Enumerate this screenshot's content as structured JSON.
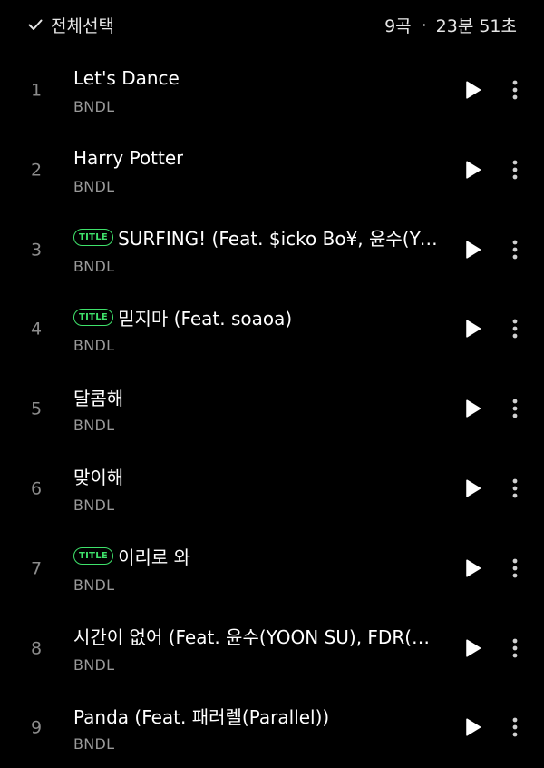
{
  "header": {
    "select_all_label": "전체선택",
    "track_count": "9곡",
    "total_duration": "23분 51초"
  },
  "colors": {
    "background": "#000000",
    "title_badge": "#3fe16b",
    "secondary_text": "#9a9a9a"
  },
  "icons": {
    "select_all": "check-icon",
    "play": "play-icon",
    "more": "more-vertical-icon"
  },
  "tracks": [
    {
      "number": "1",
      "title": "Let's Dance",
      "artist": "BNDL",
      "badge": ""
    },
    {
      "number": "2",
      "title": "Harry Potter",
      "artist": "BNDL",
      "badge": ""
    },
    {
      "number": "3",
      "title": "SURFING! (Feat. $icko Bo¥, 윤수(YO…",
      "artist": "BNDL",
      "badge": "TITLE"
    },
    {
      "number": "4",
      "title": "믿지마 (Feat. soaoa)",
      "artist": "BNDL",
      "badge": "TITLE"
    },
    {
      "number": "5",
      "title": "달콤해",
      "artist": "BNDL",
      "badge": ""
    },
    {
      "number": "6",
      "title": "맞이해",
      "artist": "BNDL",
      "badge": ""
    },
    {
      "number": "7",
      "title": "이리로 와",
      "artist": "BNDL",
      "badge": "TITLE"
    },
    {
      "number": "8",
      "title": "시간이 없어 (Feat. 윤수(YOON SU), FDR(에…",
      "artist": "BNDL",
      "badge": ""
    },
    {
      "number": "9",
      "title": "Panda (Feat. 패러렐(Parallel))",
      "artist": "BNDL",
      "badge": ""
    }
  ]
}
